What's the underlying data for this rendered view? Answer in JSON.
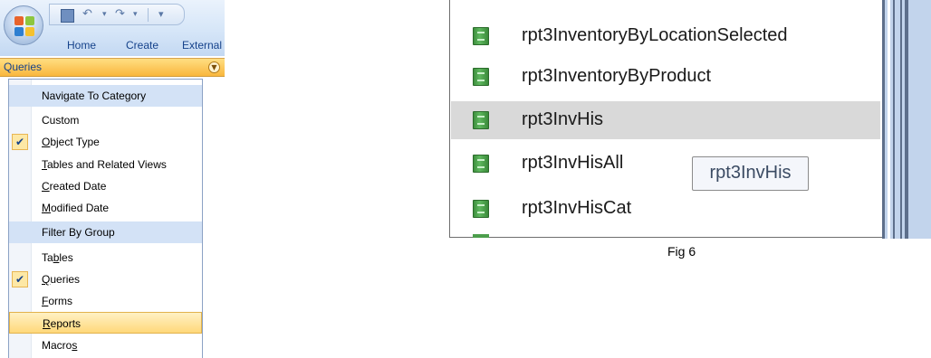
{
  "ribbon": {
    "tabs": [
      "Home",
      "Create",
      "External"
    ],
    "qat_icons": [
      "save-icon",
      "undo-icon",
      "redo-icon",
      "customize-icon"
    ]
  },
  "nav_pane": {
    "category": "Queries",
    "menu": {
      "header_navigate": "Navigate To Category",
      "header_filter": "Filter By Group",
      "items": [
        {
          "pre": "Custom",
          "u": "",
          "post": "",
          "checked": false
        },
        {
          "pre": "",
          "u": "O",
          "post": "bject Type",
          "checked": true
        },
        {
          "pre": "",
          "u": "T",
          "post": "ables and Related Views",
          "checked": false
        },
        {
          "pre": "",
          "u": "C",
          "post": "reated Date",
          "checked": false
        },
        {
          "pre": "",
          "u": "M",
          "post": "odified Date",
          "checked": false
        },
        {
          "pre": "Ta",
          "u": "b",
          "post": "les",
          "checked": false
        },
        {
          "pre": "",
          "u": "Q",
          "post": "ueries",
          "checked": true
        },
        {
          "pre": "",
          "u": "F",
          "post": "orms",
          "checked": false
        },
        {
          "pre": "",
          "u": "R",
          "post": "eports",
          "checked": false,
          "hovered": true
        },
        {
          "pre": "Macro",
          "u": "s",
          "post": "",
          "checked": false
        }
      ]
    }
  },
  "reports": {
    "items": [
      "rpt3InventoryByLocationSelected",
      "rpt3InventoryByProduct",
      "rpt3InvHis",
      "rpt3InvHisAll",
      "rpt3InvHisCat"
    ],
    "selected_index": 2,
    "tooltip": "rpt3InvHis"
  },
  "caption": "Fig 6",
  "colors": {
    "category_bar": "#f9b73d",
    "menu_header": "#d3e2f6",
    "selected_row": "#d9d9d9",
    "report_icon": "#4c9e4c"
  }
}
